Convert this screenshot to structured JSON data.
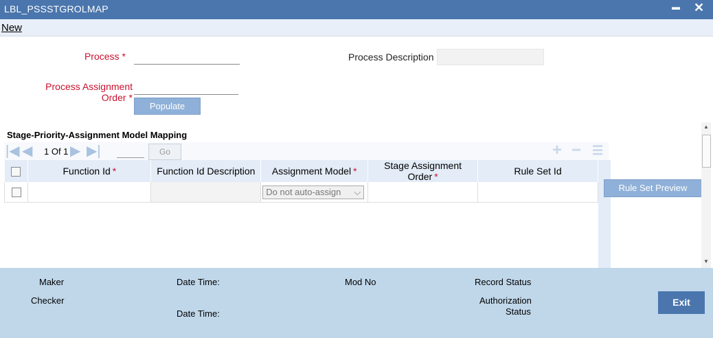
{
  "window": {
    "title": "LBL_PSSSTGROLMAP",
    "minimize": "▬",
    "close": "✕"
  },
  "menu": {
    "new_label": "New"
  },
  "form": {
    "process_label": "Process",
    "process_value": "",
    "process_description_label": "Process Description",
    "process_description_value": "",
    "assignment_order_label": "Process Assignment Order",
    "assignment_order_value": "",
    "required_marker": "*",
    "populate_label": "Populate"
  },
  "grid": {
    "title": "Stage-Priority-Assignment Model Mapping",
    "page_text": "1 Of 1",
    "go_label": "Go",
    "add_icon": "+",
    "remove_icon": "−",
    "columns": [
      {
        "label": "Function Id",
        "required": true
      },
      {
        "label": "Function Id Description",
        "required": false
      },
      {
        "label": "Assignment Model",
        "required": true
      },
      {
        "label": "Stage Assignment Order",
        "required": true
      },
      {
        "label": "Rule Set Id",
        "required": false
      }
    ],
    "row": {
      "function_id": "",
      "function_desc": "",
      "assignment_model": "Do not auto-assign",
      "stage_order": "",
      "rule_set_id": ""
    },
    "rule_set_preview_label": "Rule Set Preview"
  },
  "footer": {
    "maker": "Maker",
    "checker": "Checker",
    "date_time": "Date Time:",
    "date_time2": "Date Time:",
    "mod_no": "Mod No",
    "record_status": "Record Status",
    "authorization_status_1": "Authorization",
    "authorization_status_2": "Status",
    "exit_label": "Exit"
  }
}
